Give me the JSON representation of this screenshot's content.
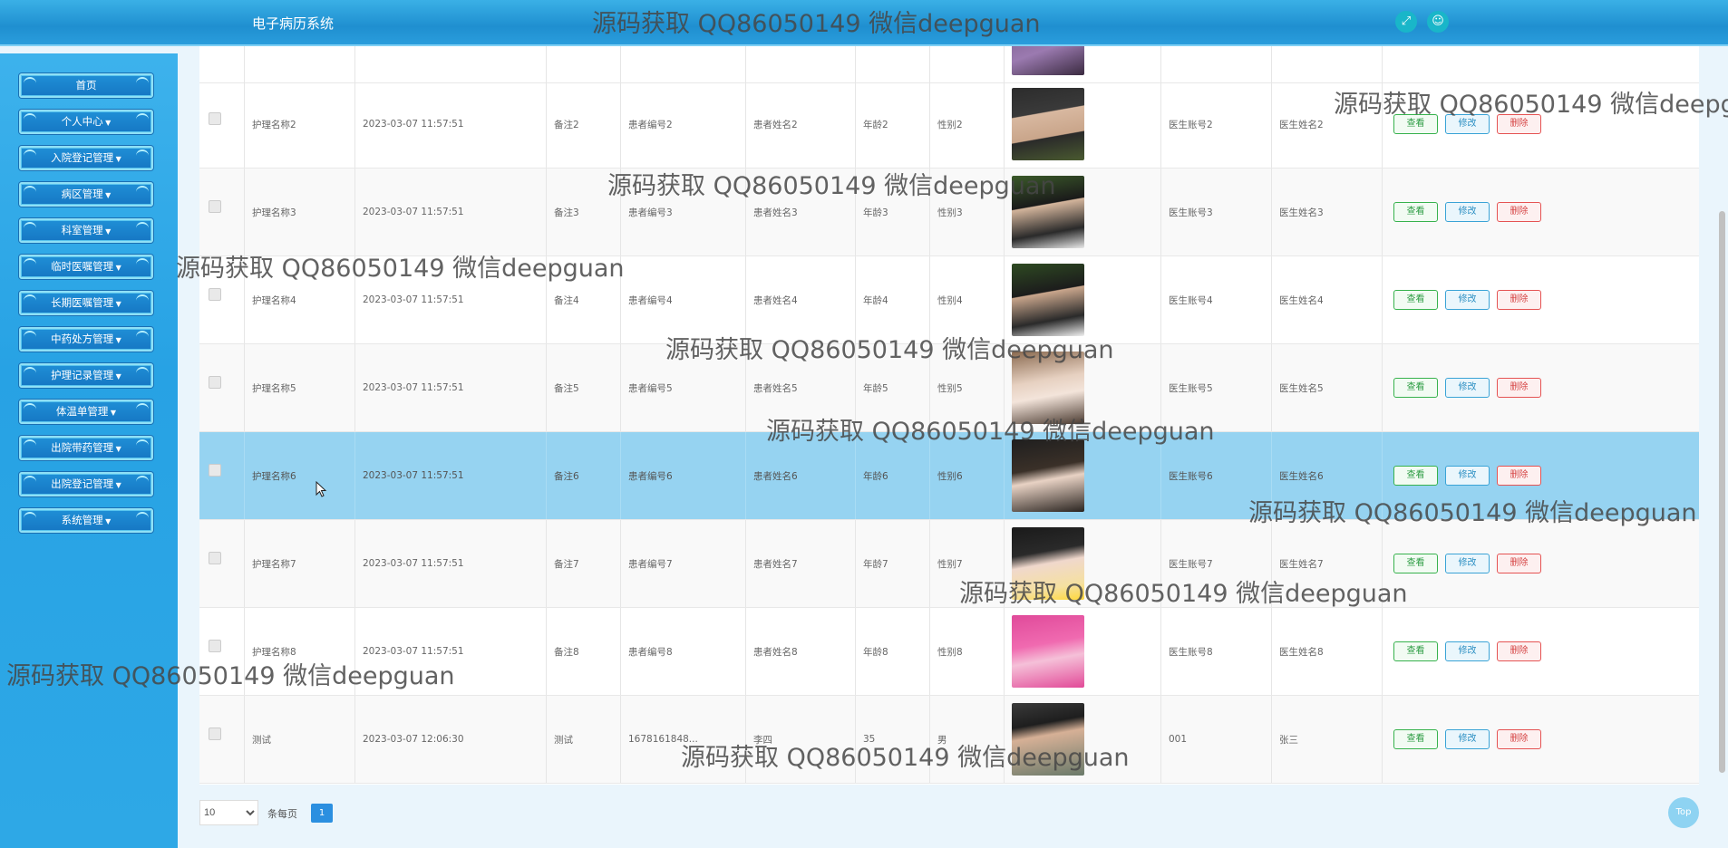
{
  "app": {
    "title": "电子病历系统",
    "fullscreen_icon": "fullscreen-icon",
    "user_icon": "user-icon",
    "accent": "#2196d6"
  },
  "sidebar": {
    "items": [
      {
        "label": "首页",
        "has_caret": false
      },
      {
        "label": "个人中心",
        "has_caret": true
      },
      {
        "label": "入院登记管理",
        "has_caret": true
      },
      {
        "label": "病区管理",
        "has_caret": true
      },
      {
        "label": "科室管理",
        "has_caret": true
      },
      {
        "label": "临时医嘱管理",
        "has_caret": true
      },
      {
        "label": "长期医嘱管理",
        "has_caret": true
      },
      {
        "label": "中药处方管理",
        "has_caret": true
      },
      {
        "label": "护理记录管理",
        "has_caret": true
      },
      {
        "label": "体温单管理",
        "has_caret": true
      },
      {
        "label": "出院带药管理",
        "has_caret": true
      },
      {
        "label": "出院登记管理",
        "has_caret": true
      },
      {
        "label": "系统管理",
        "has_caret": true
      }
    ]
  },
  "table": {
    "rows": [
      {
        "name": "护理名称2",
        "time": "2023-03-07 11:57:51",
        "note": "备注2",
        "patient_no": "患者编号2",
        "patient_name": "患者姓名2",
        "age": "年龄2",
        "gender": "性别2",
        "doctor_account": "医生账号2",
        "doctor_name": "医生姓名2",
        "selected": false
      },
      {
        "name": "护理名称3",
        "time": "2023-03-07 11:57:51",
        "note": "备注3",
        "patient_no": "患者编号3",
        "patient_name": "患者姓名3",
        "age": "年龄3",
        "gender": "性别3",
        "doctor_account": "医生账号3",
        "doctor_name": "医生姓名3",
        "selected": false
      },
      {
        "name": "护理名称4",
        "time": "2023-03-07 11:57:51",
        "note": "备注4",
        "patient_no": "患者编号4",
        "patient_name": "患者姓名4",
        "age": "年龄4",
        "gender": "性别4",
        "doctor_account": "医生账号4",
        "doctor_name": "医生姓名4",
        "selected": false
      },
      {
        "name": "护理名称5",
        "time": "2023-03-07 11:57:51",
        "note": "备注5",
        "patient_no": "患者编号5",
        "patient_name": "患者姓名5",
        "age": "年龄5",
        "gender": "性别5",
        "doctor_account": "医生账号5",
        "doctor_name": "医生姓名5",
        "selected": false
      },
      {
        "name": "护理名称6",
        "time": "2023-03-07 11:57:51",
        "note": "备注6",
        "patient_no": "患者编号6",
        "patient_name": "患者姓名6",
        "age": "年龄6",
        "gender": "性别6",
        "doctor_account": "医生账号6",
        "doctor_name": "医生姓名6",
        "selected": true
      },
      {
        "name": "护理名称7",
        "time": "2023-03-07 11:57:51",
        "note": "备注7",
        "patient_no": "患者编号7",
        "patient_name": "患者姓名7",
        "age": "年龄7",
        "gender": "性别7",
        "doctor_account": "医生账号7",
        "doctor_name": "医生姓名7",
        "selected": false
      },
      {
        "name": "护理名称8",
        "time": "2023-03-07 11:57:51",
        "note": "备注8",
        "patient_no": "患者编号8",
        "patient_name": "患者姓名8",
        "age": "年龄8",
        "gender": "性别8",
        "doctor_account": "医生账号8",
        "doctor_name": "医生姓名8",
        "selected": false
      },
      {
        "name": "测试",
        "time": "2023-03-07 12:06:30",
        "note": "测试",
        "patient_no": "1678161848...",
        "patient_name": "李四",
        "age": "35",
        "gender": "男",
        "doctor_account": "001",
        "doctor_name": "张三",
        "selected": false
      }
    ],
    "actions": {
      "view": "查看",
      "edit": "修改",
      "delete": "删除"
    },
    "selected_row_color": "#96d3f1"
  },
  "pagination": {
    "page_size_value": "10",
    "page_size_label": "条每页",
    "current_page": "1"
  },
  "back_to_top_label": "Top",
  "watermark": {
    "text": "源码获取 QQ86050149 微信deepguan"
  }
}
